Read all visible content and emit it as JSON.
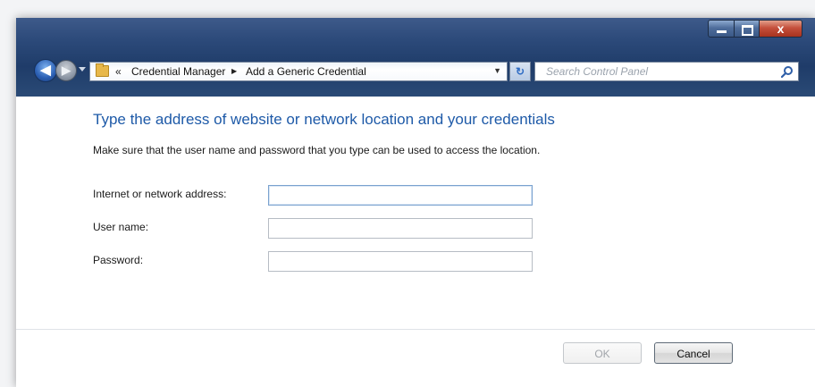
{
  "window": {
    "caption_buttons": {
      "close_glyph": "x"
    }
  },
  "nav": {
    "back_glyph": "◀",
    "forward_glyph": "▶",
    "address": {
      "chevrons": "«",
      "crumb1": "Credential Manager",
      "crumb_separator": "▶",
      "crumb2": "Add a Generic Credential",
      "dropdown_glyph": "▼"
    },
    "refresh_glyph": "↻",
    "search_placeholder": "Search Control Panel"
  },
  "form": {
    "heading": "Type the address of website or network location and your credentials",
    "instruction": "Make sure that the user name and password that you type can be used to access the location.",
    "fields": [
      {
        "label": "Internet or network address:",
        "value": ""
      },
      {
        "label": "User name:",
        "value": ""
      },
      {
        "label": "Password:",
        "value": ""
      }
    ]
  },
  "buttons": {
    "ok_label": "OK",
    "cancel_label": "Cancel",
    "ok_enabled": false
  },
  "colors": {
    "heading": "#1e5aa8",
    "titlebar": "#2c4a7a",
    "close_button": "#c5503c"
  },
  "icons": {
    "back": "back-arrow-icon",
    "forward": "forward-arrow-icon",
    "folder": "control-panel-folder-icon",
    "refresh": "refresh-icon",
    "search": "search-icon"
  }
}
